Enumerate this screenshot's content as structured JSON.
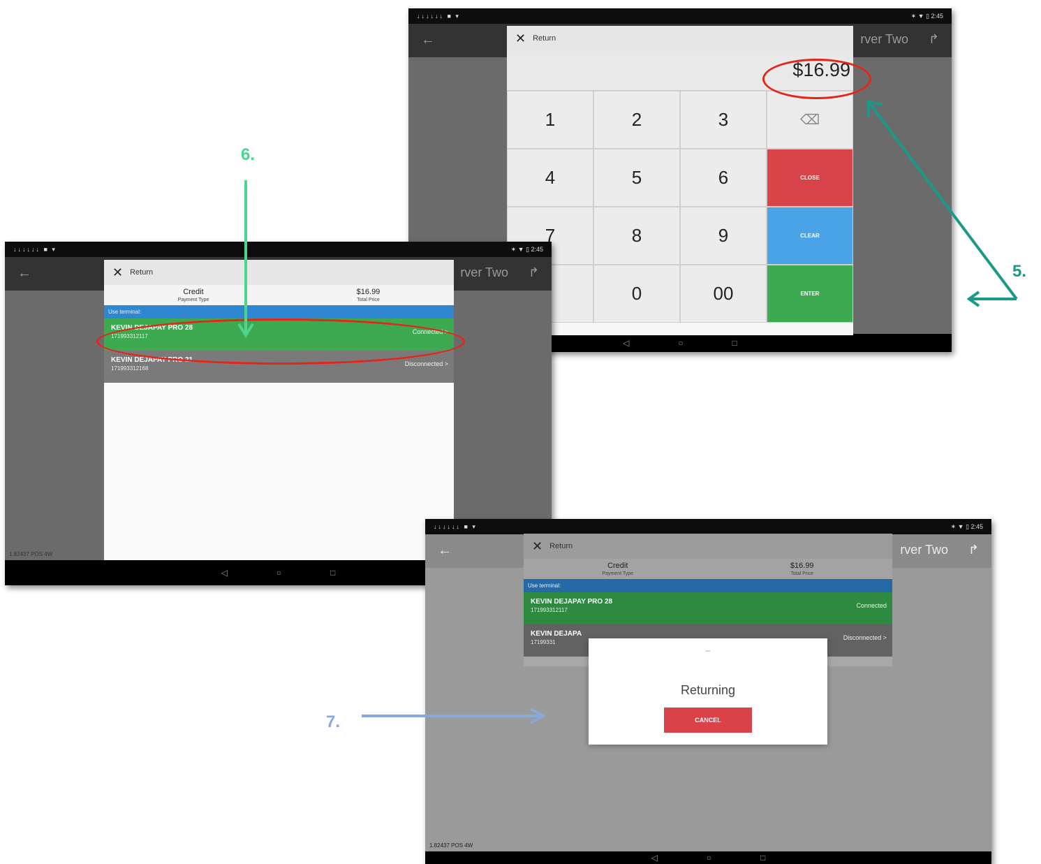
{
  "steps": {
    "five": "5.",
    "six": "6.",
    "seven": "7."
  },
  "common": {
    "back_glyph": "←",
    "server_name": "rver Two",
    "server_name_partial": "rver Two",
    "logout_glyph": "↱",
    "status_left": "↓↓↓↓↓↓ ■ ▾",
    "status_right": "✶ ▼ ▯ 2:45",
    "nav_back": "◁",
    "nav_home": "○",
    "nav_recent": "□",
    "version": "1.82437 POS 4W"
  },
  "keypad_screen": {
    "dialog_title": "Return",
    "close_glyph": "✕",
    "amount": "$16.99",
    "keys": [
      "1",
      "2",
      "3",
      "⌫",
      "4",
      "5",
      "6",
      "CLOSE",
      "7",
      "8",
      "9",
      "CLEAR",
      "",
      "0",
      "00",
      "ENTER"
    ]
  },
  "device_screen": {
    "dialog_title": "Return",
    "close_glyph": "✕",
    "payment_type_value": "Credit",
    "payment_type_label": "Payment Type",
    "total_value": "$16.99",
    "total_label": "Total Price",
    "list_header": "Use terminal:",
    "devices": [
      {
        "name": "KEVIN DEJAPAY PRO 28",
        "serial": "171993312117",
        "state": "Connected >"
      },
      {
        "name": "KEVIN DEJAPAY PRO 21",
        "serial": "171993312168",
        "state": "Disconnected >"
      }
    ]
  },
  "returning_screen": {
    "dialog_title": "Return",
    "close_glyph": "✕",
    "payment_type_value": "Credit",
    "payment_type_label": "Payment Type",
    "total_value": "$16.99",
    "total_label": "Total Price",
    "list_header": "Use terminal:",
    "devices": [
      {
        "name": "KEVIN DEJAPAY PRO 28",
        "serial": "171993312117",
        "state": "Connected"
      },
      {
        "name": "KEVIN DEJAPA",
        "serial": "17199331",
        "state": "Disconnected >"
      }
    ],
    "popup_dash": "–",
    "popup_message": "Returning",
    "cancel_label": "CANCEL"
  },
  "colors": {
    "step5": "#1a9a86",
    "step6": "#4fd38e",
    "step7": "#8aa9d8",
    "highlight": "#e3261b"
  }
}
